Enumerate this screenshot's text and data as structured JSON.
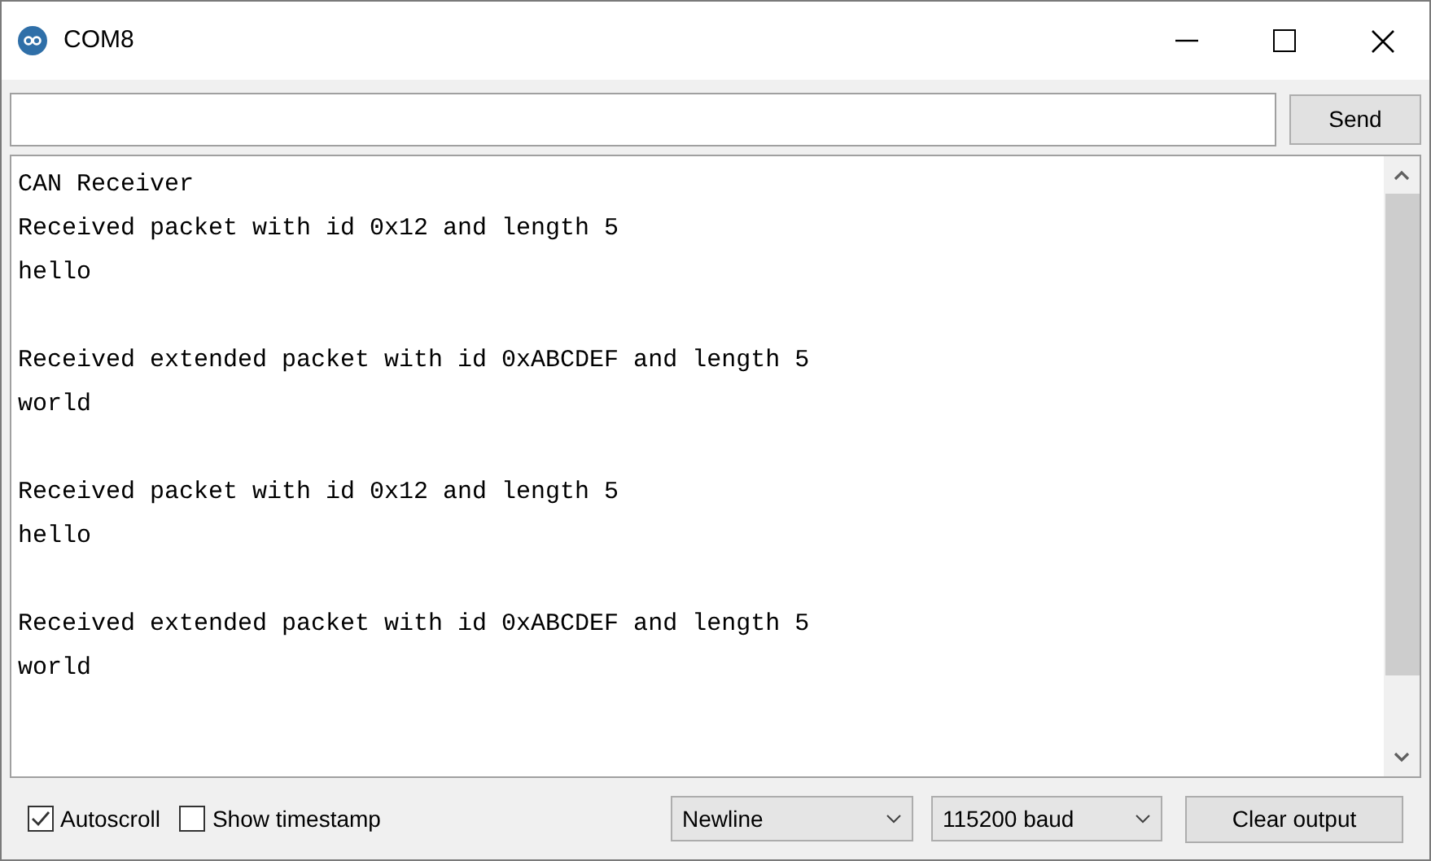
{
  "window": {
    "title": "COM8"
  },
  "send_bar": {
    "button": "Send"
  },
  "output": {
    "blocks": [
      [
        "CAN Receiver",
        "Received packet with id 0x12 and length 5",
        "hello"
      ],
      [
        "Received extended packet with id 0xABCDEF and length 5",
        "world"
      ],
      [
        "Received packet with id 0x12 and length 5",
        "hello"
      ],
      [
        "Received extended packet with id 0xABCDEF and length 5",
        "world"
      ]
    ]
  },
  "options": [
    {
      "label": "Autoscroll",
      "checked": true
    },
    {
      "label": "Show timestamp",
      "checked": false
    }
  ],
  "line_ending": {
    "value": "Newline"
  },
  "baud_rate": {
    "value": "115200 baud"
  },
  "clear_button": "Clear output"
}
